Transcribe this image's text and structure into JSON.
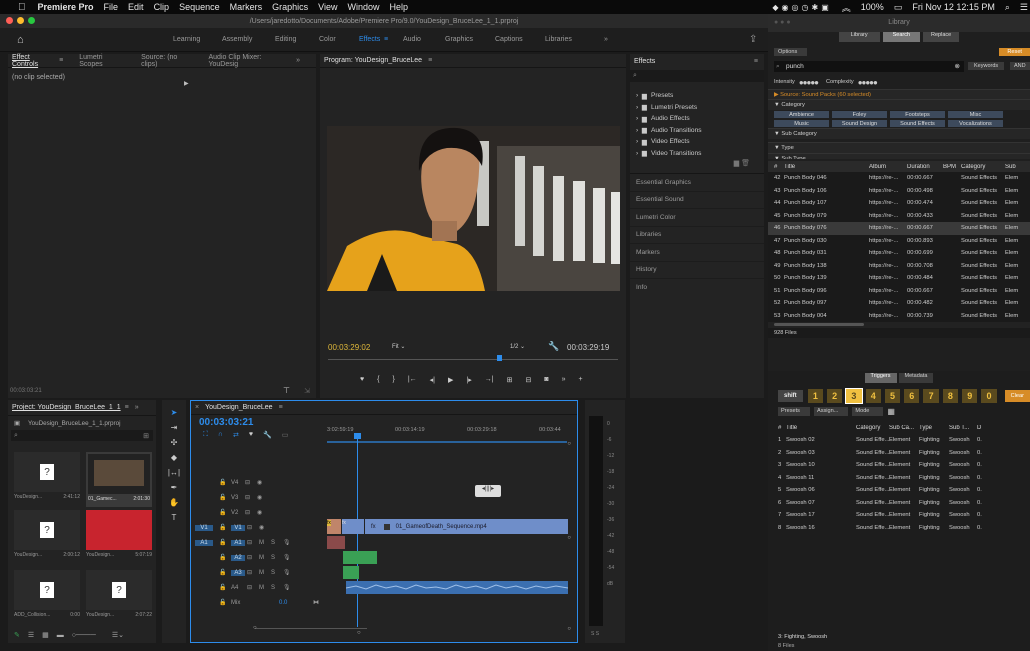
{
  "menubar": {
    "app": "Premiere Pro",
    "items": [
      "File",
      "Edit",
      "Clip",
      "Sequence",
      "Markers",
      "Graphics",
      "View",
      "Window",
      "Help"
    ],
    "battery": "100%",
    "clock": "Fri Nov 12  12:15 PM"
  },
  "titlebar": {
    "path": "/Users/jaredotto/Documents/Adobe/Premiere Pro/9.0/YouDesign_BruceLee_1_1.prproj"
  },
  "workspaces": [
    "Learning",
    "Assembly",
    "Editing",
    "Color",
    "Effects",
    "Audio",
    "Graphics",
    "Captions",
    "Libraries"
  ],
  "workspaces_active": "Effects",
  "source_panel": {
    "tabs": [
      "Effect Controls",
      "Lumetri Scopes",
      "Source: (no clips)",
      "Audio Clip Mixer: YouDesig"
    ],
    "status": "(no clip selected)",
    "timecode": "00:03:03:21"
  },
  "program": {
    "title": "Program: YouDesign_BruceLee",
    "timecode_left": "00:03:29:02",
    "fit": "Fit",
    "resolution": "1/2",
    "timecode_right": "00:03:29:19"
  },
  "effects": {
    "title": "Effects",
    "items": [
      "Presets",
      "Lumetri Presets",
      "Audio Effects",
      "Audio Transitions",
      "Video Effects",
      "Video Transitions"
    ],
    "sections": [
      "Essential Graphics",
      "Essential Sound",
      "Lumetri Color",
      "Libraries",
      "Markers",
      "History",
      "Info"
    ]
  },
  "project": {
    "title": "Project: YouDesign_BruceLee_1_1",
    "file": "YouDesign_BruceLee_1_1.prproj",
    "items": [
      {
        "name": "YouDesign...",
        "dur": "2:41:12"
      },
      {
        "name": "01_Gamec...",
        "dur": "2:01:30"
      },
      {
        "name": "YouDesign...",
        "dur": "2:00:12"
      },
      {
        "name": "YouDesign...",
        "dur": "5:07:19"
      },
      {
        "name": "ADD_Collision...",
        "dur": "0:00"
      },
      {
        "name": "YouDesign...",
        "dur": "2:07:22"
      }
    ]
  },
  "timeline": {
    "title": "YouDesign_BruceLee",
    "timecode": "00:03:03:21",
    "ruler": [
      "3:02:59:19",
      "00:03:14:19",
      "00:03:29:18",
      "00:03:44"
    ],
    "tracks": [
      "V4",
      "V3",
      "V2",
      "V1",
      "A1",
      "A2",
      "A3",
      "A4"
    ],
    "mix_label": "Mix",
    "mix_value": "0.0",
    "clip_name": "01_GameofDeath_Sequence.mp4"
  },
  "meter": {
    "scale": [
      "0",
      "-6",
      "-12",
      "-18",
      "-24",
      "-30",
      "-36",
      "-42",
      "-48",
      "-54",
      "dB"
    ],
    "ss": "S  S"
  },
  "library": {
    "title": "Library",
    "tabs": [
      "Library",
      "Search",
      "Replace"
    ],
    "options": "Options",
    "reset": "Reset",
    "search_value": "punch",
    "keywords": "Keywords",
    "and": "AND",
    "intensity": "Intensity",
    "complexity": "Complexity",
    "source": "▶ Source: Sound Packs (60 selected)",
    "category_head": "▼ Category",
    "categories": [
      "Ambience",
      "Foley",
      "Footsteps",
      "Misc",
      "Music",
      "Sound Design",
      "Sound Effects",
      "Vocalizations"
    ],
    "sub_category": "▼ Sub Category",
    "type": "▼ Type",
    "sub_type": "▼ Sub Type",
    "columns": [
      "#",
      "Title",
      "Album",
      "Duration",
      "BPM",
      "Category",
      "Sub"
    ],
    "rows": [
      [
        "42",
        "Punch Body 046",
        "https://re-...",
        "00:00.667",
        "",
        "Sound Effects",
        "Elem"
      ],
      [
        "43",
        "Punch Body 106",
        "https://re-...",
        "00:00.498",
        "",
        "Sound Effects",
        "Elem"
      ],
      [
        "44",
        "Punch Body 107",
        "https://re-...",
        "00:00.474",
        "",
        "Sound Effects",
        "Elem"
      ],
      [
        "45",
        "Punch Body 079",
        "https://re-...",
        "00:00.433",
        "",
        "Sound Effects",
        "Elem"
      ],
      [
        "46",
        "Punch Body 076",
        "https://re-...",
        "00:00.667",
        "",
        "Sound Effects",
        "Elem"
      ],
      [
        "47",
        "Punch Body 030",
        "https://re-...",
        "00:00.893",
        "",
        "Sound Effects",
        "Elem"
      ],
      [
        "48",
        "Punch Body 031",
        "https://re-...",
        "00:00.699",
        "",
        "Sound Effects",
        "Elem"
      ],
      [
        "49",
        "Punch Body 138",
        "https://re-...",
        "00:00.708",
        "",
        "Sound Effects",
        "Elem"
      ],
      [
        "50",
        "Punch Body 139",
        "https://re-...",
        "00:00.484",
        "",
        "Sound Effects",
        "Elem"
      ],
      [
        "51",
        "Punch Body 096",
        "https://re-...",
        "00:00.667",
        "",
        "Sound Effects",
        "Elem"
      ],
      [
        "52",
        "Punch Body 097",
        "https://re-...",
        "00:00.482",
        "",
        "Sound Effects",
        "Elem"
      ],
      [
        "53",
        "Punch Body 004",
        "https://re-...",
        "00:00.739",
        "",
        "Sound Effects",
        "Elem"
      ]
    ],
    "file_count": "928 Files",
    "triggers_tabs": [
      "Triggers",
      "Metadata"
    ],
    "shift": "shift",
    "keys": [
      "1",
      "2",
      "3",
      "4",
      "5",
      "6",
      "7",
      "8",
      "9",
      "0"
    ],
    "clear": "Clear",
    "presets": "Presets",
    "assign": "Assign...",
    "mode": "Mode",
    "columns2": [
      "#",
      "Title",
      "Category",
      "Sub Ca...",
      "Type",
      "Sub T...",
      "D"
    ],
    "rows2": [
      [
        "1",
        "Swoosh 02",
        "Sound Effe...",
        "Element",
        "Fighting",
        "Swoosh",
        "0."
      ],
      [
        "2",
        "Swoosh 03",
        "Sound Effe...",
        "Element",
        "Fighting",
        "Swoosh",
        "0."
      ],
      [
        "3",
        "Swoosh 10",
        "Sound Effe...",
        "Element",
        "Fighting",
        "Swoosh",
        "0."
      ],
      [
        "4",
        "Swoosh 11",
        "Sound Effe...",
        "Element",
        "Fighting",
        "Swoosh",
        "0."
      ],
      [
        "5",
        "Swoosh 06",
        "Sound Effe...",
        "Element",
        "Fighting",
        "Swoosh",
        "0."
      ],
      [
        "6",
        "Swoosh 07",
        "Sound Effe...",
        "Element",
        "Fighting",
        "Swoosh",
        "0."
      ],
      [
        "7",
        "Swoosh 17",
        "Sound Effe...",
        "Element",
        "Fighting",
        "Swoosh",
        "0."
      ],
      [
        "8",
        "Swoosh 16",
        "Sound Effe...",
        "Element",
        "Fighting",
        "Swoosh",
        "0."
      ]
    ],
    "footer_title": "3: Fighting, Swoosh",
    "footer_count": "8 Files"
  },
  "colors": {
    "accent": "#2d8ceb",
    "clip_video": "#6f8ec9",
    "clip_audio": "#3b6fb0",
    "clip_green": "#3aa055",
    "key_gold": "#f0c040"
  }
}
